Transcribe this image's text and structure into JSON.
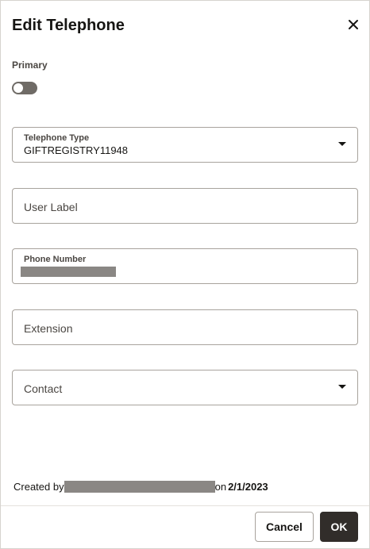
{
  "dialog": {
    "title": "Edit Telephone",
    "close_icon": "close-icon"
  },
  "primary": {
    "label": "Primary",
    "enabled": false
  },
  "fields": {
    "telephone_type": {
      "label": "Telephone Type",
      "value": "GIFTREGISTRY11948"
    },
    "user_label": {
      "placeholder": "User Label"
    },
    "phone_number": {
      "label": "Phone Number"
    },
    "extension": {
      "placeholder": "Extension"
    },
    "contact": {
      "placeholder": "Contact"
    }
  },
  "footer": {
    "created_by_prefix": "Created by",
    "created_on_prefix": "on",
    "created_date": "2/1/2023",
    "cancel_label": "Cancel",
    "ok_label": "OK"
  },
  "colors": {
    "primary_button": "#312d2a",
    "toggle_off": "#6f6b66",
    "border": "#a8a39d"
  }
}
